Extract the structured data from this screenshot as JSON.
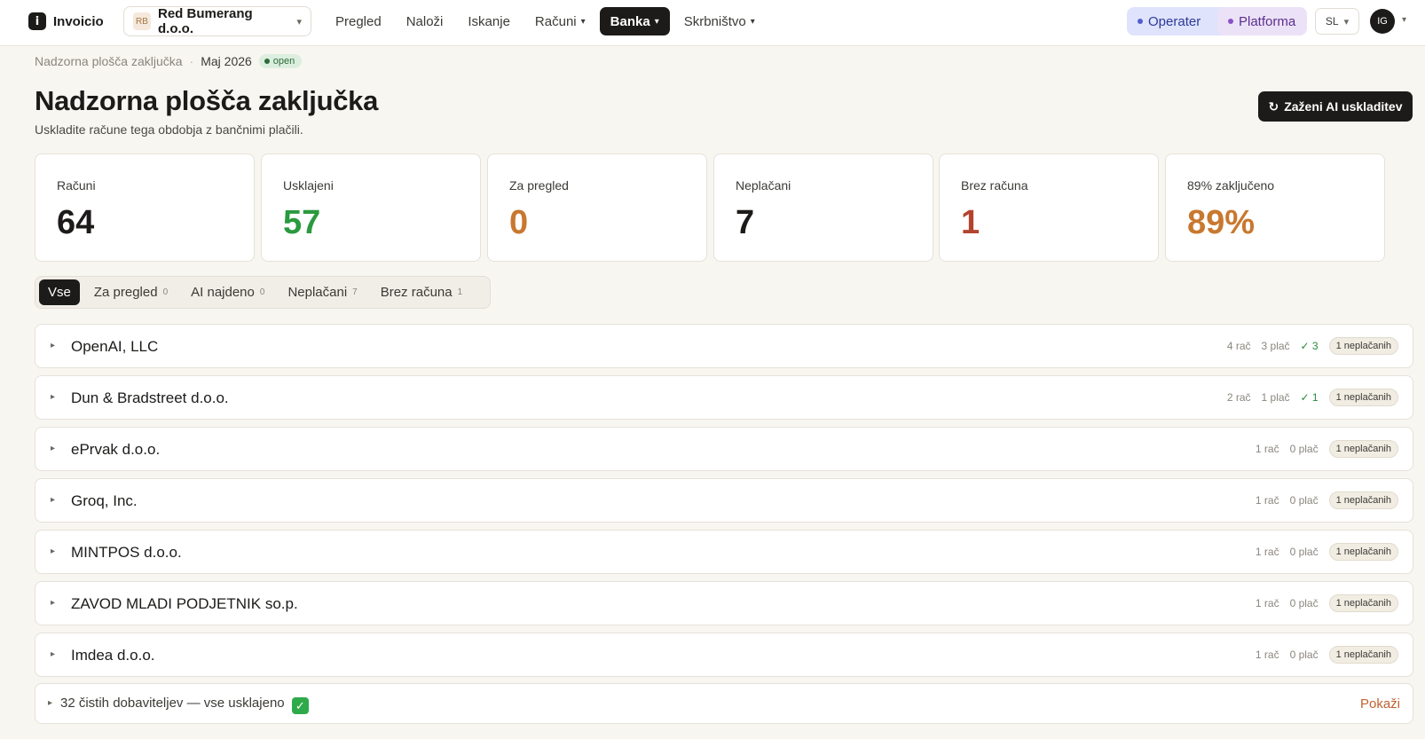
{
  "app": {
    "name": "Invoicio",
    "logo_glyph": "i"
  },
  "company": {
    "initials": "RB",
    "name": "Red Bumerang d.o.o."
  },
  "nav": [
    {
      "label": "Pregled",
      "dropdown": false,
      "active": false
    },
    {
      "label": "Naloži",
      "dropdown": false,
      "active": false
    },
    {
      "label": "Iskanje",
      "dropdown": false,
      "active": false
    },
    {
      "label": "Računi",
      "dropdown": true,
      "active": false
    },
    {
      "label": "Banka",
      "dropdown": true,
      "active": true
    },
    {
      "label": "Skrbništvo",
      "dropdown": true,
      "active": false
    }
  ],
  "roles": {
    "operator": "Operater",
    "platform": "Platforma"
  },
  "language": "SL",
  "user": {
    "initials": "IG"
  },
  "breadcrumb": {
    "root": "Nadzorna plošča zaključka",
    "separator": "·",
    "current": "Maj 2026",
    "status": "open"
  },
  "page": {
    "title": "Nadzorna plošča zaključka",
    "subtitle": "Uskladite račune tega obdobja z bančnimi plačili.",
    "action_icon": "↻",
    "action_label": "Zaženi AI uskladitev"
  },
  "stats": [
    {
      "label": "Računi",
      "value": "64",
      "color": "#1c1b19"
    },
    {
      "label": "Usklajeni",
      "value": "57",
      "color": "#2a9a3e"
    },
    {
      "label": "Za pregled",
      "value": "0",
      "color": "#c8782f"
    },
    {
      "label": "Neplačani",
      "value": "7",
      "color": "#1c1b19"
    },
    {
      "label": "Brez računa",
      "value": "1",
      "color": "#b4432e"
    },
    {
      "label": "89% zaključeno",
      "value": "89%",
      "color": "#c8782f"
    }
  ],
  "filters": [
    {
      "label": "Vse",
      "count": "",
      "active": true
    },
    {
      "label": "Za pregled",
      "count": "0",
      "active": false
    },
    {
      "label": "AI najdeno",
      "count": "0",
      "active": false
    },
    {
      "label": "Neplačani",
      "count": "7",
      "active": false
    },
    {
      "label": "Brez računa",
      "count": "1",
      "active": false
    }
  ],
  "vendors": [
    {
      "name": "OpenAI, LLC",
      "invoices": "4 rač",
      "payments": "3 plač",
      "matched": "✓ 3",
      "badge": "1 neplačanih"
    },
    {
      "name": "Dun & Bradstreet d.o.o.",
      "invoices": "2 rač",
      "payments": "1 plač",
      "matched": "✓ 1",
      "badge": "1 neplačanih"
    },
    {
      "name": "ePrvak d.o.o.",
      "invoices": "1 rač",
      "payments": "0 plač",
      "matched": "",
      "badge": "1 neplačanih"
    },
    {
      "name": "Groq, Inc.",
      "invoices": "1 rač",
      "payments": "0 plač",
      "matched": "",
      "badge": "1 neplačanih"
    },
    {
      "name": "MINTPOS d.o.o.",
      "invoices": "1 rač",
      "payments": "0 plač",
      "matched": "",
      "badge": "1 neplačanih"
    },
    {
      "name": "ZAVOD MLADI PODJETNIK so.p.",
      "invoices": "1 rač",
      "payments": "0 plač",
      "matched": "",
      "badge": "1 neplačanih"
    },
    {
      "name": "Imdea d.o.o.",
      "invoices": "1 rač",
      "payments": "0 plač",
      "matched": "",
      "badge": "1 neplačanih"
    }
  ],
  "clean": {
    "text": "32 čistih dobaviteljev — vse usklajeno",
    "emoji": "✓",
    "action": "Pokaži"
  }
}
